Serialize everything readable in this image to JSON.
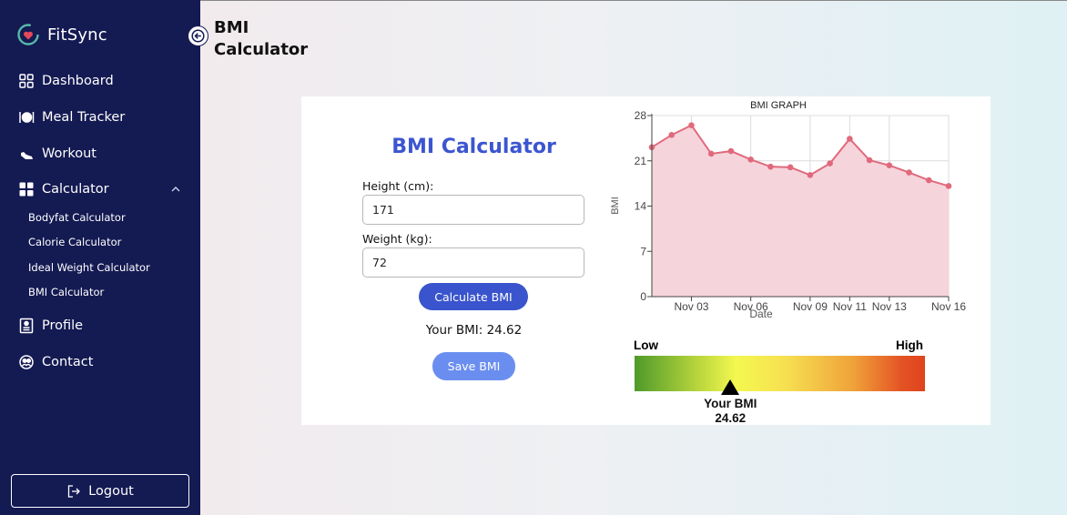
{
  "app": {
    "name": "FitSync",
    "logo_icon": "heart-sync-icon"
  },
  "sidebar": {
    "items": [
      {
        "label": "Dashboard",
        "icon": "grid-icon"
      },
      {
        "label": "Meal Tracker",
        "icon": "plate-cutlery-icon"
      },
      {
        "label": "Workout",
        "icon": "shoe-icon"
      },
      {
        "label": "Calculator",
        "icon": "calculator-icon",
        "expanded": true
      },
      {
        "label": "Profile",
        "icon": "profile-card-icon"
      },
      {
        "label": "Contact",
        "icon": "contact-users-icon"
      }
    ],
    "sub_items": [
      {
        "label": "Bodyfat Calculator"
      },
      {
        "label": "Calorie Calculator"
      },
      {
        "label": "Ideal Weight Calculator"
      },
      {
        "label": "BMI Calculator"
      }
    ],
    "logout_label": "Logout"
  },
  "header": {
    "title": "BMI Calculator"
  },
  "form": {
    "title": "BMI Calculator",
    "height_label": "Height (cm):",
    "height_value": "171",
    "weight_label": "Weight (kg):",
    "weight_value": "72",
    "calculate_label": "Calculate BMI",
    "result_text": "Your BMI: 24.62",
    "save_label": "Save BMI"
  },
  "scale": {
    "low_label": "Low",
    "high_label": "High",
    "caption": "Your BMI",
    "value": "24.62",
    "position_fraction": 0.33
  },
  "colors": {
    "sidebar_bg": "#141a52",
    "accent": "#3954cc",
    "save_button": "#6a8ef0",
    "title_blue": "#3c55d0",
    "line": "#e06a7c",
    "area": "#f6d2da"
  },
  "chart_data": {
    "type": "area",
    "title": "BMI GRAPH",
    "xlabel": "Date",
    "ylabel": "BMI",
    "ylim": [
      0,
      28
    ],
    "yticks": [
      0,
      7,
      14,
      21,
      28
    ],
    "xlim": [
      0,
      15
    ],
    "xticks": [
      {
        "label": "Nov 03",
        "x": 2
      },
      {
        "label": "Nov 06",
        "x": 5
      },
      {
        "label": "Nov 09",
        "x": 8
      },
      {
        "label": "Nov 11",
        "x": 10
      },
      {
        "label": "Nov 13",
        "x": 12
      },
      {
        "label": "Nov 16",
        "x": 15
      }
    ],
    "grid": true,
    "series": [
      {
        "x": [
          0,
          1,
          2,
          3,
          4,
          5,
          6,
          7,
          8,
          9,
          10,
          11,
          12,
          13,
          14,
          15
        ],
        "values": [
          23.1,
          25.0,
          26.5,
          22.1,
          22.5,
          21.2,
          20.1,
          20.0,
          18.8,
          20.6,
          24.4,
          21.1,
          20.3,
          19.2,
          18.0,
          17.1
        ]
      }
    ]
  }
}
